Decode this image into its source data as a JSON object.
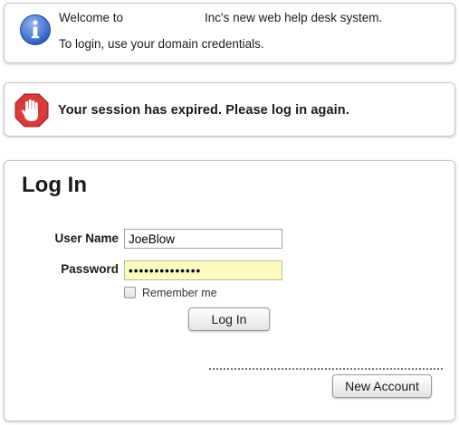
{
  "info": {
    "line1": "Welcome to                        Inc's new web help desk system.",
    "line2": "To login, use your domain credentials.",
    "icon": "info-icon"
  },
  "error": {
    "message": "Your session has expired.  Please log in again.",
    "icon": "stop-hand-icon"
  },
  "login": {
    "title": "Log In",
    "username_label": "User Name",
    "username_value": "JoeBlow",
    "password_label": "Password",
    "password_value": "••••••••••••••",
    "remember_label": "Remember me",
    "remember_checked": false,
    "login_button": "Log In",
    "new_account_button": "New Account"
  },
  "colors": {
    "info_blue": "#3b6fc9",
    "error_red": "#d93a3a",
    "password_highlight": "#fbfcc0"
  }
}
